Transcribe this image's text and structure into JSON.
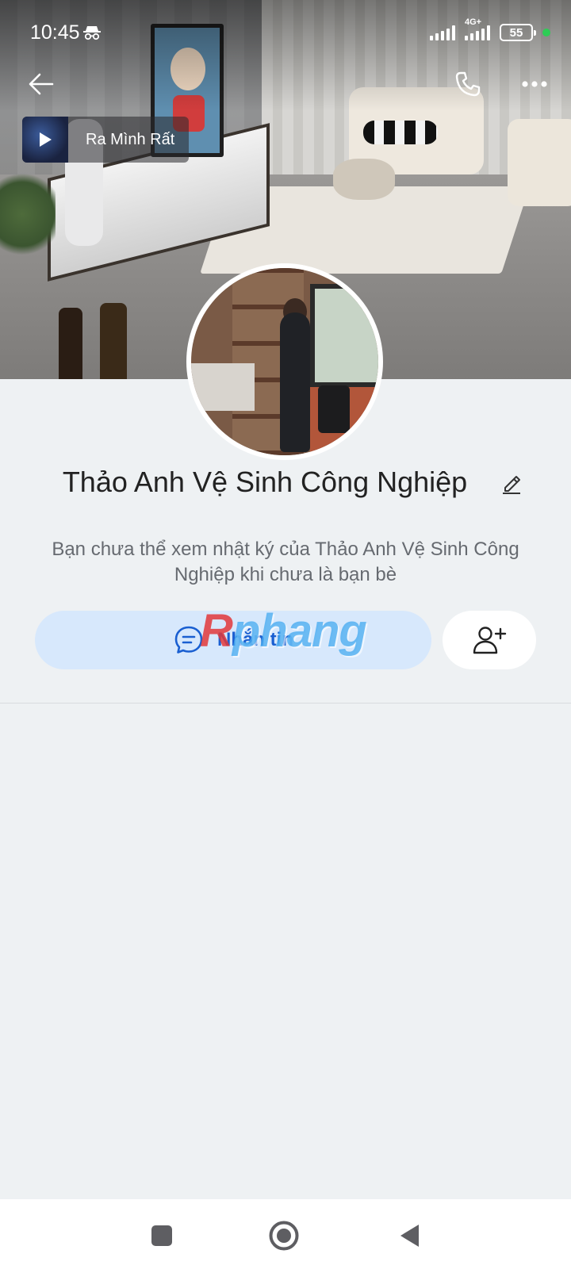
{
  "status_bar": {
    "time": "10:45",
    "network_type": "4G+",
    "battery_level": "55",
    "incognito_icon": "incognito-icon",
    "active_indicator_color": "#2ecc55"
  },
  "nav": {
    "back_icon": "arrow-left-icon",
    "call_icon": "phone-icon",
    "more_icon": "more-horizontal-icon"
  },
  "music": {
    "title": "Ra Mình Rất",
    "play_icon": "play-icon"
  },
  "profile": {
    "name": "Thảo Anh Vệ Sinh Công Nghiệp",
    "notice": "Bạn chưa thể xem nhật ký của Thảo Anh Vệ Sinh Công Nghiệp khi chưa là bạn bè",
    "edit_icon": "pencil-icon"
  },
  "actions": {
    "message_label": "Nhắn tin",
    "message_icon": "chat-bubble-icon",
    "add_friend_icon": "add-user-icon"
  },
  "watermark": {
    "first_letter": "R",
    "rest": "phang"
  },
  "system_nav": {
    "recents_icon": "square-icon",
    "home_icon": "circle-icon",
    "back_icon": "triangle-back-icon"
  },
  "colors": {
    "accent": "#1a5fd1",
    "message_button_bg": "#d7e8fc",
    "page_bg": "#eef1f3"
  }
}
